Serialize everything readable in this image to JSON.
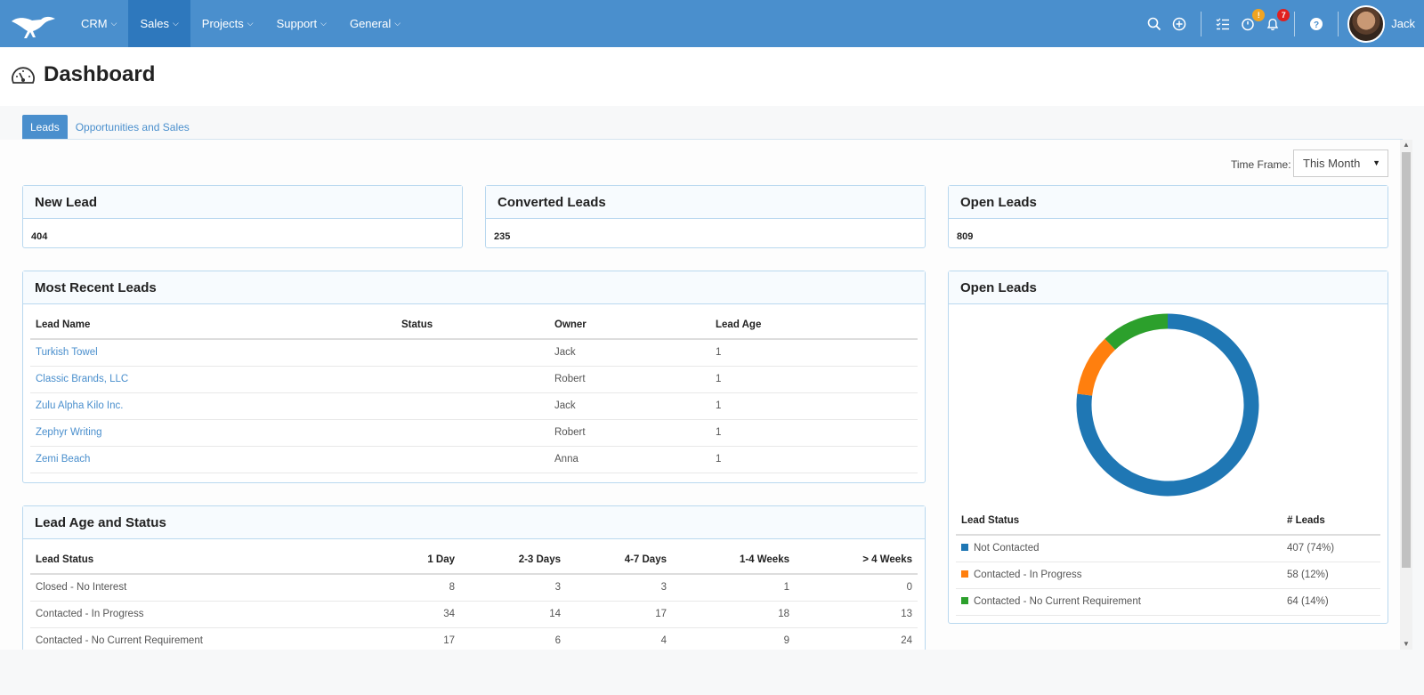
{
  "nav": {
    "items": [
      {
        "label": "CRM",
        "active": false
      },
      {
        "label": "Sales",
        "active": true
      },
      {
        "label": "Projects",
        "active": false
      },
      {
        "label": "Support",
        "active": false
      },
      {
        "label": "General",
        "active": false
      }
    ],
    "chevron": "⌵",
    "icons": [
      "search-icon",
      "add-circle-icon",
      "task-list-icon",
      "timer-icon",
      "bell-icon",
      "help-icon"
    ],
    "timer_badge": "!",
    "notification_badge": "7",
    "user_name": "Jack"
  },
  "page": {
    "title": "Dashboard"
  },
  "tabs": [
    {
      "label": "Leads",
      "active": true
    },
    {
      "label": "Opportunities and Sales",
      "active": false
    }
  ],
  "timeframe": {
    "label": "Time Frame:",
    "value": "This Month",
    "caret": "▼"
  },
  "stats": [
    {
      "title": "New Lead",
      "value": "404"
    },
    {
      "title": "Converted Leads",
      "value": "235"
    },
    {
      "title": "Open Leads",
      "value": "809"
    }
  ],
  "recent_leads": {
    "title": "Most Recent Leads",
    "columns": [
      "Lead Name",
      "Status",
      "Owner",
      "Lead Age"
    ],
    "rows": [
      [
        "Turkish Towel",
        "",
        "Jack",
        "1"
      ],
      [
        "Classic Brands, LLC",
        "",
        "Robert",
        "1"
      ],
      [
        "Zulu Alpha Kilo Inc.",
        "",
        "Jack",
        "1"
      ],
      [
        "Zephyr Writing",
        "",
        "Robert",
        "1"
      ],
      [
        "Zemi Beach",
        "",
        "Anna",
        "1"
      ]
    ]
  },
  "lead_age": {
    "title": "Lead Age and Status",
    "columns": [
      "Lead Status",
      "1 Day",
      "2-3 Days",
      "4-7 Days",
      "1-4 Weeks",
      "> 4 Weeks"
    ],
    "rows": [
      [
        "Closed - No Interest",
        "8",
        "3",
        "3",
        "1",
        "0"
      ],
      [
        "Contacted - In Progress",
        "34",
        "14",
        "17",
        "18",
        "13"
      ],
      [
        "Contacted - No Current Requirement",
        "17",
        "6",
        "4",
        "9",
        "24"
      ]
    ]
  },
  "open_leads_chart": {
    "title": "Open Leads",
    "columns": [
      "Lead Status",
      "# Leads"
    ],
    "rows": [
      {
        "status": "Not Contacted",
        "count": "407 (74%)",
        "color": "#1f77b4"
      },
      {
        "status": "Contacted - In Progress",
        "count": "58 (12%)",
        "color": "#ff7f0e"
      },
      {
        "status": "Contacted - No Current Requirement",
        "count": "64 (14%)",
        "color": "#2ca02c"
      }
    ]
  },
  "chart_data": {
    "type": "pie",
    "title": "Open Leads",
    "categories": [
      "Not Contacted",
      "Contacted - In Progress",
      "Contacted - No Current Requirement"
    ],
    "values": [
      407,
      58,
      64
    ],
    "colors": [
      "#1f77b4",
      "#ff7f0e",
      "#2ca02c"
    ],
    "donut": true
  }
}
